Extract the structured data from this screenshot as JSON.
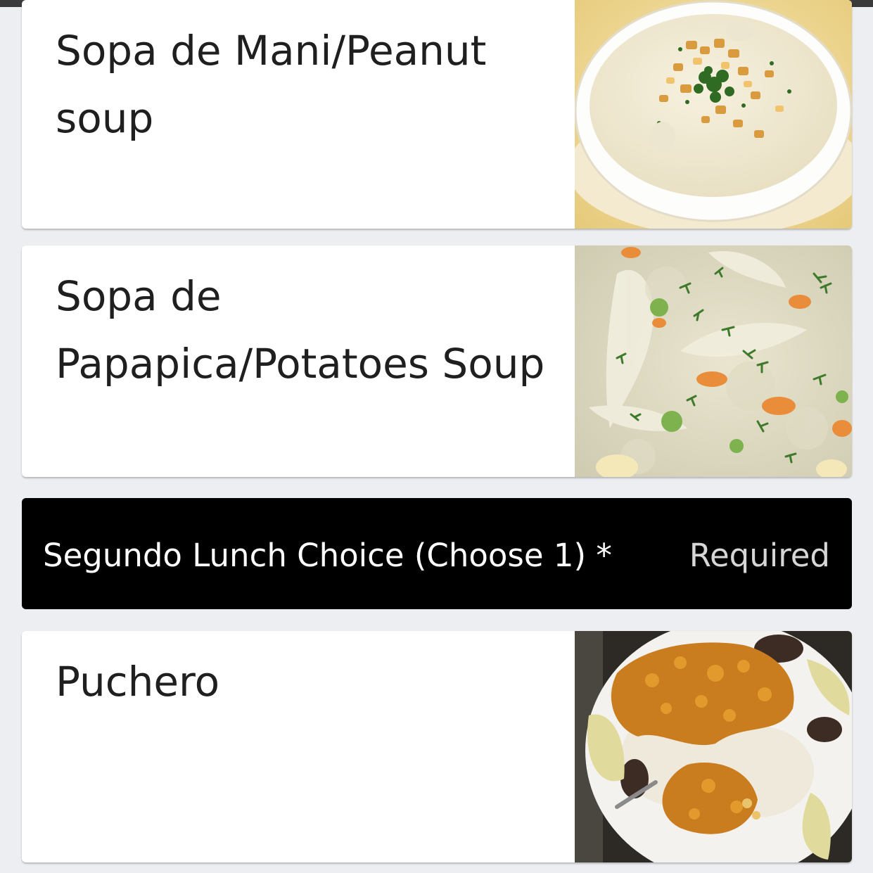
{
  "menu": {
    "items_before": [
      {
        "name": "Sopa de Mani/Peanut soup",
        "photo": "peanut-soup-photo"
      },
      {
        "name": "Sopa de Papapica/Potatoes Soup",
        "photo": "potato-soup-photo"
      }
    ],
    "section": {
      "title": "Segundo Lunch Choice (Choose 1) *",
      "badge": "Required"
    },
    "items_after": [
      {
        "name": "Puchero",
        "photo": "puchero-photo"
      }
    ]
  }
}
